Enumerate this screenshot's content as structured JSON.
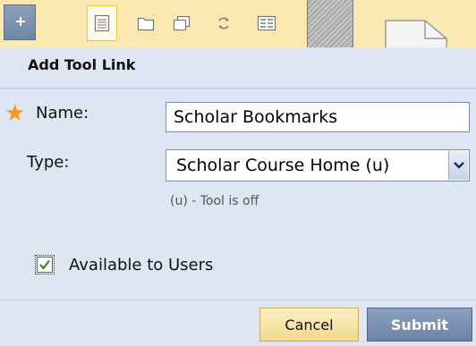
{
  "toolbar": {
    "icons": [
      "add-icon",
      "page-icon",
      "folder-icon",
      "window-icon",
      "refresh-icon",
      "grid-icon",
      "document-icon"
    ]
  },
  "form": {
    "title": "Add Tool Link",
    "required_marker": "★",
    "name_label": "Name:",
    "name_value": "Scholar Bookmarks",
    "type_label": "Type:",
    "type_value": "Scholar Course Home (u)",
    "type_hint": "(u) - Tool is off",
    "available_label": "Available to Users",
    "available_checked": true
  },
  "buttons": {
    "cancel": "Cancel",
    "submit": "Submit"
  },
  "colors": {
    "toolbar_bg": "#fbe8b0",
    "panel_bg": "#dde6f2",
    "required_star": "#f39a1e",
    "submit_bg": "#6c84a7",
    "checkmark": "#2a8f2a"
  }
}
